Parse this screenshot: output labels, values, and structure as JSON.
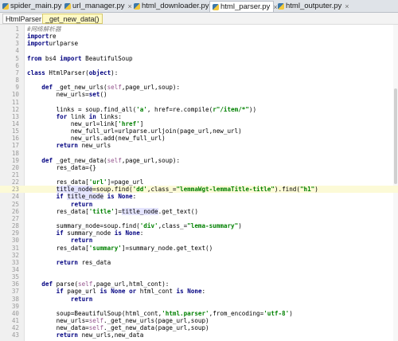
{
  "tabs": [
    {
      "label": "spider_main.py",
      "active": false
    },
    {
      "label": "url_manager.py",
      "active": false
    },
    {
      "label": "html_downloader.py",
      "active": false
    },
    {
      "label": "html_parser.py",
      "active": true
    },
    {
      "label": "html_outputer.py",
      "active": false
    }
  ],
  "breadcrumb": [
    "HtmlParser",
    "_get_new_data()"
  ],
  "highlighted_line": 23,
  "lines": [
    {
      "n": 1,
      "tokens": [
        [
          "cm",
          "#网络解析器"
        ]
      ]
    },
    {
      "n": 2,
      "tokens": [
        [
          "kw",
          "import"
        ],
        [
          "",
          "re"
        ]
      ]
    },
    {
      "n": 3,
      "tokens": [
        [
          "kw",
          "import"
        ],
        [
          "",
          "urlparse"
        ]
      ]
    },
    {
      "n": 4,
      "tokens": []
    },
    {
      "n": 5,
      "tokens": [
        [
          "kw",
          "from"
        ],
        [
          "",
          " bs4 "
        ],
        [
          "kw",
          "import"
        ],
        [
          "",
          " BeautifulSoup"
        ]
      ]
    },
    {
      "n": 6,
      "tokens": []
    },
    {
      "n": 7,
      "tokens": [
        [
          "kw",
          "class"
        ],
        [
          "",
          " HtmlParser("
        ],
        [
          "kw",
          "object"
        ],
        [
          "",
          "):"
        ]
      ]
    },
    {
      "n": 8,
      "tokens": []
    },
    {
      "n": 9,
      "tokens": [
        [
          "",
          "    "
        ],
        [
          "kw",
          "def"
        ],
        [
          "",
          " _get_new_urls("
        ],
        [
          "sf",
          "self"
        ],
        [
          "",
          ",page_url,soup):"
        ]
      ]
    },
    {
      "n": 10,
      "tokens": [
        [
          "",
          "        new_urls="
        ],
        [
          "kw",
          "set"
        ],
        [
          "",
          "()"
        ]
      ]
    },
    {
      "n": 11,
      "tokens": []
    },
    {
      "n": 12,
      "tokens": [
        [
          "",
          "        links = soup.find_all("
        ],
        [
          "st",
          "'a'"
        ],
        [
          "",
          ", "
        ],
        [
          "",
          "href"
        ],
        [
          "",
          "=re.compile("
        ],
        [
          "st",
          "r\"/item/*\""
        ],
        [
          "",
          "))"
        ]
      ]
    },
    {
      "n": 13,
      "tokens": [
        [
          "",
          "        "
        ],
        [
          "kw",
          "for"
        ],
        [
          "",
          " link "
        ],
        [
          "kw",
          "in"
        ],
        [
          "",
          " links:"
        ]
      ]
    },
    {
      "n": 14,
      "tokens": [
        [
          "",
          "            new_url=link["
        ],
        [
          "st",
          "'href'"
        ],
        [
          "",
          "]"
        ]
      ]
    },
    {
      "n": 15,
      "tokens": [
        [
          "",
          "            new_full_url=urlparse.urljoin(page_url,new_url)"
        ]
      ]
    },
    {
      "n": 16,
      "tokens": [
        [
          "",
          "            new_urls.add(new_full_url)"
        ]
      ]
    },
    {
      "n": 17,
      "tokens": [
        [
          "",
          "        "
        ],
        [
          "kw",
          "return"
        ],
        [
          "",
          " new_urls"
        ]
      ]
    },
    {
      "n": 18,
      "tokens": []
    },
    {
      "n": 19,
      "tokens": [
        [
          "",
          "    "
        ],
        [
          "kw",
          "def"
        ],
        [
          "",
          " _get_new_data("
        ],
        [
          "sf",
          "self"
        ],
        [
          "",
          ",page_url,soup):"
        ]
      ]
    },
    {
      "n": 20,
      "tokens": [
        [
          "",
          "        res_data={}"
        ]
      ]
    },
    {
      "n": 21,
      "tokens": []
    },
    {
      "n": 22,
      "tokens": [
        [
          "",
          "        res_data["
        ],
        [
          "st",
          "'url'"
        ],
        [
          "",
          "]=page_url"
        ]
      ]
    },
    {
      "n": 23,
      "tokens": [
        [
          "",
          "        "
        ],
        [
          "ref",
          "title_node"
        ],
        [
          "",
          "=soup.find("
        ],
        [
          "st",
          "'dd'"
        ],
        [
          "",
          ",class_="
        ],
        [
          "st",
          "\"lemmaWgt-lemmaTitle-title\""
        ],
        [
          "",
          ").find("
        ],
        [
          "st",
          "\"h1\""
        ],
        [
          "",
          ")"
        ]
      ]
    },
    {
      "n": 24,
      "tokens": [
        [
          "",
          "        "
        ],
        [
          "kw",
          "if"
        ],
        [
          "",
          " "
        ],
        [
          "ref",
          "title_node"
        ],
        [
          "",
          " "
        ],
        [
          "kw",
          "is"
        ],
        [
          "",
          " "
        ],
        [
          "kw",
          "None"
        ],
        [
          "",
          ":"
        ]
      ]
    },
    {
      "n": 25,
      "tokens": [
        [
          "",
          "            "
        ],
        [
          "kw",
          "return"
        ]
      ]
    },
    {
      "n": 26,
      "tokens": [
        [
          "",
          "        res_data["
        ],
        [
          "st",
          "'title'"
        ],
        [
          "",
          "]="
        ],
        [
          "ref",
          "title_node"
        ],
        [
          "",
          ".get_text()"
        ]
      ]
    },
    {
      "n": 27,
      "tokens": []
    },
    {
      "n": 28,
      "tokens": [
        [
          "",
          "        summary_node=soup.find("
        ],
        [
          "st",
          "'div'"
        ],
        [
          "",
          ",class_="
        ],
        [
          "st",
          "\"lema-summary\""
        ],
        [
          "",
          ")"
        ]
      ]
    },
    {
      "n": 29,
      "tokens": [
        [
          "",
          "        "
        ],
        [
          "kw",
          "if"
        ],
        [
          "",
          " summary_node "
        ],
        [
          "kw",
          "is"
        ],
        [
          "",
          " "
        ],
        [
          "kw",
          "None"
        ],
        [
          "",
          ":"
        ]
      ]
    },
    {
      "n": 30,
      "tokens": [
        [
          "",
          "            "
        ],
        [
          "kw",
          "return"
        ]
      ]
    },
    {
      "n": 31,
      "tokens": [
        [
          "",
          "        res_data["
        ],
        [
          "st",
          "'summary'"
        ],
        [
          "",
          "]=summary_node.get_text()"
        ]
      ]
    },
    {
      "n": 32,
      "tokens": []
    },
    {
      "n": 33,
      "tokens": [
        [
          "",
          "        "
        ],
        [
          "kw",
          "return"
        ],
        [
          "",
          " res_data"
        ]
      ]
    },
    {
      "n": 34,
      "tokens": []
    },
    {
      "n": 35,
      "tokens": []
    },
    {
      "n": 36,
      "tokens": [
        [
          "",
          "    "
        ],
        [
          "kw",
          "def"
        ],
        [
          "",
          " parse("
        ],
        [
          "sf",
          "self"
        ],
        [
          "",
          ",page_url,html_cont):"
        ]
      ]
    },
    {
      "n": 37,
      "tokens": [
        [
          "",
          "        "
        ],
        [
          "kw",
          "if"
        ],
        [
          "",
          " page_url "
        ],
        [
          "kw",
          "is"
        ],
        [
          "",
          " "
        ],
        [
          "kw",
          "None"
        ],
        [
          "",
          " "
        ],
        [
          "kw",
          "or"
        ],
        [
          "",
          " html_cont "
        ],
        [
          "kw",
          "is"
        ],
        [
          "",
          " "
        ],
        [
          "kw",
          "None"
        ],
        [
          "",
          ":"
        ]
      ]
    },
    {
      "n": 38,
      "tokens": [
        [
          "",
          "            "
        ],
        [
          "kw",
          "return"
        ]
      ]
    },
    {
      "n": 39,
      "tokens": []
    },
    {
      "n": 40,
      "tokens": [
        [
          "",
          "        soup=BeautifulSoup(html_cont,"
        ],
        [
          "st",
          "'html.parser'"
        ],
        [
          "",
          ","
        ],
        [
          "",
          "from_encoding="
        ],
        [
          "st",
          "'utf-8'"
        ],
        [
          "",
          ")"
        ]
      ]
    },
    {
      "n": 41,
      "tokens": [
        [
          "",
          "        new_urls="
        ],
        [
          "sf",
          "self"
        ],
        [
          "",
          "._get_new_urls(page_url,soup)"
        ]
      ]
    },
    {
      "n": 42,
      "tokens": [
        [
          "",
          "        new_data="
        ],
        [
          "sf",
          "self"
        ],
        [
          "",
          "._get_new_data(page_url,soup)"
        ]
      ]
    },
    {
      "n": 43,
      "tokens": [
        [
          "",
          "        "
        ],
        [
          "kw",
          "return"
        ],
        [
          "",
          " new_urls,new_data"
        ]
      ]
    }
  ]
}
